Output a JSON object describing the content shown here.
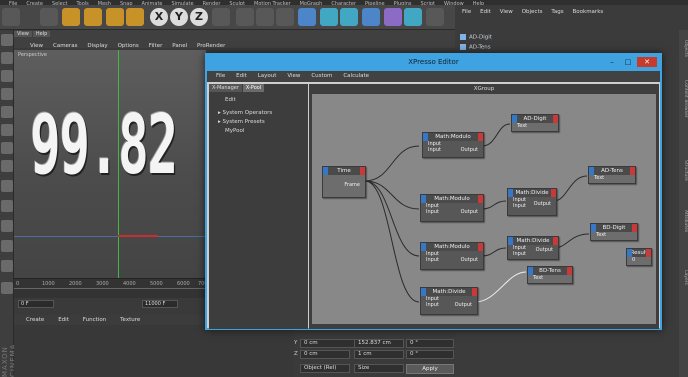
{
  "menubar": [
    "File",
    "Create",
    "Select",
    "Tools",
    "Mesh",
    "Snap",
    "Animate",
    "Simulate",
    "Render",
    "Sculpt",
    "Motion Tracker",
    "MoGraph",
    "Character",
    "Pipeline",
    "Plugins",
    "Script",
    "Window",
    "Help"
  ],
  "viewport": {
    "tabs": [
      "View",
      "Help"
    ],
    "menu": [
      "View",
      "Cameras",
      "Display",
      "Options",
      "Filter",
      "Panel",
      "ProRender"
    ],
    "label": "Perspective",
    "display_text": "99.82"
  },
  "timeline": {
    "ticks": [
      "0",
      "1000",
      "2000",
      "3000",
      "4000",
      "5000",
      "6000",
      "7000"
    ],
    "start_frame": "0 F",
    "end_frame": "11000 F"
  },
  "material_menu": [
    "Create",
    "Edit",
    "Function",
    "Texture"
  ],
  "brand": "MAXON CINEMA 4D",
  "object_manager": {
    "menu": [
      "File",
      "Edit",
      "View",
      "Objects",
      "Tags",
      "Bookmarks"
    ],
    "objects": [
      "AD-Digit",
      "AD-Tens"
    ]
  },
  "side_tabs": [
    "Objects",
    "Content Browser",
    "Structure",
    "Attributes",
    "Layers"
  ],
  "attributes": {
    "rows": [
      {
        "p": "0 cm",
        "s": "152.837 cm",
        "r": "0 °"
      },
      {
        "p": "0 cm",
        "s": "1 cm",
        "r": "0 °"
      }
    ],
    "mode_left": "Object (Rel)",
    "mode_mid": "Size",
    "apply": "Apply"
  },
  "xpresso": {
    "title": "XPresso Editor",
    "menu": [
      "File",
      "Edit",
      "Layout",
      "View",
      "Custom",
      "Calculate"
    ],
    "left_tabs": [
      "X-Manager",
      "X-Pool"
    ],
    "left_edit": "Edit",
    "pool_items": [
      "System Operators",
      "System Presets",
      "MyPool"
    ],
    "group_title": "XGroup",
    "nodes": {
      "time": {
        "title": "Time",
        "out": "Frame"
      },
      "mod1": {
        "title": "Math:Modulo",
        "in1": "Input",
        "in2": "Input",
        "out": "Output"
      },
      "mod2": {
        "title": "Math:Modulo",
        "in1": "Input",
        "in2": "Input",
        "out": "Output"
      },
      "mod3": {
        "title": "Math:Modulo",
        "in1": "Input",
        "in2": "Input",
        "out": "Output"
      },
      "div1": {
        "title": "Math:Divide",
        "in1": "Input",
        "in2": "Input",
        "out": "Output"
      },
      "div2": {
        "title": "Math:Divide",
        "in1": "Input",
        "in2": "Input",
        "out": "Output"
      },
      "div3": {
        "title": "Math:Divide",
        "in1": "Input",
        "in2": "Input",
        "out": "Output"
      },
      "adDigit": {
        "title": "AD-Digit",
        "port": "Text"
      },
      "adTens": {
        "title": "AD-Tens",
        "port": "Text"
      },
      "bdDigit": {
        "title": "BD-Digit",
        "port": "Text"
      },
      "bdTens": {
        "title": "BD-Tens",
        "port": "Text"
      },
      "result": {
        "title": "Result",
        "port": "0"
      }
    }
  },
  "colors": {
    "xpresso_frame": "#3ea3e0",
    "close_button": "#c63b2b",
    "node_input_port": "#3677c6",
    "node_output_port": "#c83a3a",
    "toolbar_highlight": "#c79227"
  }
}
